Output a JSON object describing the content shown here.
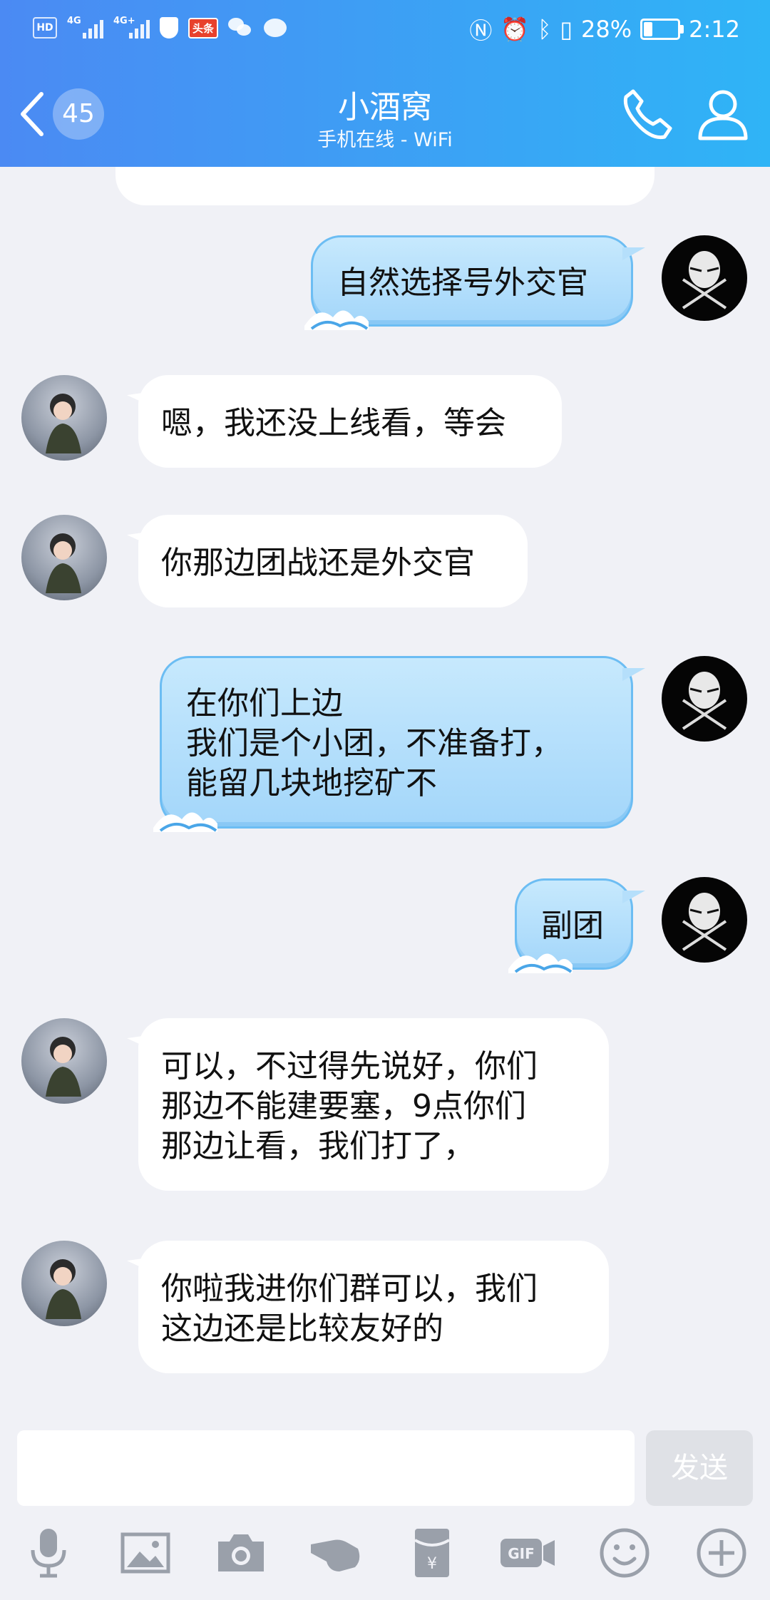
{
  "status_bar": {
    "hd": "HD",
    "net1": "4G",
    "net2": "4G+",
    "toutiao": "头条",
    "battery_percent": "28%",
    "battery_level": 0.28,
    "time": "2:12"
  },
  "header": {
    "unread_count": "45",
    "title": "小酒窝",
    "subtitle": "手机在线 - WiFi"
  },
  "messages": [
    {
      "side": "out",
      "lines": [
        "自然选择号外交官"
      ]
    },
    {
      "side": "in",
      "lines": [
        "嗯，我还没上线看，等会"
      ]
    },
    {
      "side": "in",
      "lines": [
        "你那边团战还是外交官"
      ]
    },
    {
      "side": "out",
      "lines": [
        "在你们上边",
        "我们是个小团，不准备打，",
        "能留几块地挖矿不"
      ]
    },
    {
      "side": "out",
      "lines": [
        "副团"
      ]
    },
    {
      "side": "in",
      "lines": [
        "可以，不过得先说好，你们",
        "那边不能建要塞，9点你们",
        "那边让看，我们打了，"
      ]
    },
    {
      "side": "in",
      "lines": [
        "你啦我进你们群可以，我们",
        "这边还是比较友好的"
      ]
    }
  ],
  "input": {
    "value": "",
    "send_label": "发送"
  },
  "toolbar": [
    "microphone-icon",
    "image-icon",
    "camera-icon",
    "hand-icon",
    "red-packet-icon",
    "gif-icon",
    "emoji-icon",
    "plus-icon"
  ],
  "colors": {
    "header_start": "#4b8af3",
    "header_end": "#2fb4f6",
    "chat_bg": "#f0f1f6",
    "outgoing_bubble": "#a3d6fa",
    "incoming_bubble": "#ffffff"
  }
}
